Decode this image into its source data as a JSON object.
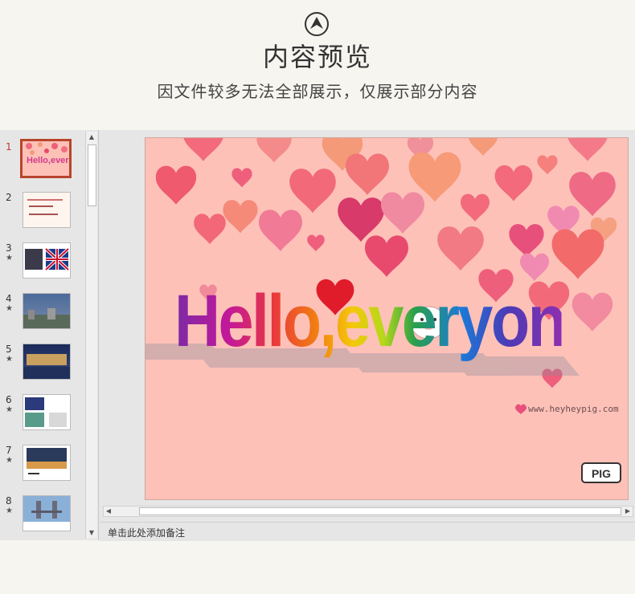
{
  "header": {
    "icon": "chevron-up-circle-icon",
    "title": "内容预览",
    "subtitle": "因文件较多无法全部展示，仅展示部分内容"
  },
  "slides_panel": {
    "thumbnails": [
      {
        "number": "1",
        "star": "",
        "active": true
      },
      {
        "number": "2",
        "star": "",
        "active": false
      },
      {
        "number": "3",
        "star": "★",
        "active": false
      },
      {
        "number": "4",
        "star": "★",
        "active": false
      },
      {
        "number": "5",
        "star": "★",
        "active": false
      },
      {
        "number": "6",
        "star": "★",
        "active": false
      },
      {
        "number": "7",
        "star": "★",
        "active": false
      },
      {
        "number": "8",
        "star": "★",
        "active": false
      }
    ]
  },
  "slide": {
    "headline": "Hello,everyone!",
    "url": "www.heyheypig.com",
    "logo_text": "PIG"
  },
  "notes": {
    "placeholder": "单击此处添加备注"
  },
  "colors": {
    "accent": "#b8452b",
    "slide_bg": "#fdc1b8"
  }
}
